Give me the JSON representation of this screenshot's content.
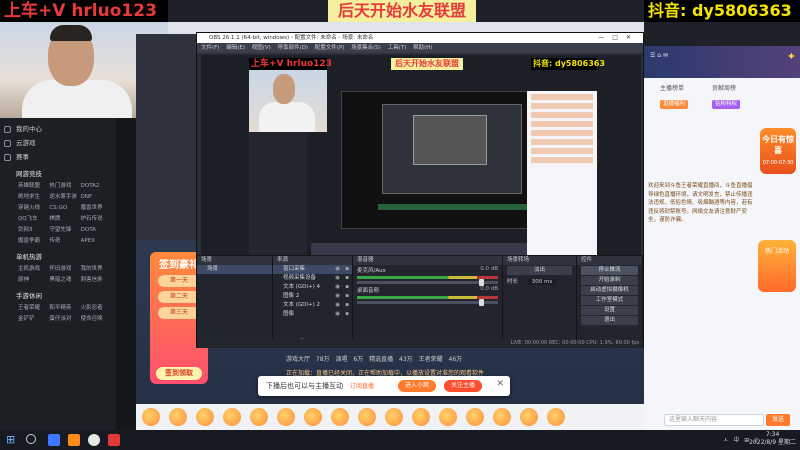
{
  "overlays": {
    "left": "上车+V hrluo123",
    "center": "后天开始水友联盟",
    "right": "抖音: dy5806363"
  },
  "obs": {
    "title": "OBS 26.1.1 (64-bit, windows) - 配置文件: 未命名 - 场景: 未命名",
    "menu": "文件(F) 编辑(E) 视图(V) 停靠部件(D) 配置文件(P) 场景集合(S) 工具(T) 帮助(H)",
    "preview_banners": {
      "left": "上车+V hrluo123",
      "center": "后天开始水友联盟",
      "right": "抖音: dy5806363"
    },
    "docks": {
      "scenes": {
        "title": "场景",
        "items": [
          "场景"
        ]
      },
      "sources": {
        "title": "来源",
        "items": [
          "窗口采集",
          "视频采集设备",
          "文本 (GDI+) 4",
          "图像 2",
          "文本 (GDI+) 2",
          "图像"
        ]
      },
      "mixer": {
        "title": "混音器",
        "channels": [
          {
            "name": "麦克风/Aux",
            "db": "0.0 dB"
          },
          {
            "name": "桌面音频",
            "db": "0.0 dB"
          }
        ]
      },
      "transitions": {
        "title": "场景转场",
        "type": "淡出",
        "duration_label": "时长",
        "duration": "300 ms"
      },
      "controls": {
        "title": "控件",
        "buttons": [
          "停止推流",
          "开始录制",
          "启动虚拟摄像机",
          "工作室模式",
          "设置",
          "退出"
        ]
      }
    },
    "status": "LIVE: 00:00:00   REC: 00:00:00   CPU: 1.9%, 60.00 fps"
  },
  "stream_list": [
    "游戏大厅",
    "78万",
    "演唱",
    "6万",
    "精选直播",
    "43万",
    "王者荣耀",
    "46万"
  ],
  "notice": "正在加载：直播已经关闭，正在帮助加载中，以播放设置对准您的观看软件",
  "popup": {
    "message": "下播后也可以与主播互动",
    "link": "订阅直播",
    "login_button": "进入小窝",
    "join_button": "关注主播"
  },
  "signin": {
    "title": "签到豪礼",
    "items": [
      "第一天",
      "第二天",
      "第三天"
    ],
    "go": "签到领取"
  },
  "sidebar": {
    "top_items": [
      "我的中心",
      "云游戏",
      "赛事"
    ],
    "sections": [
      {
        "title": "网游竞技",
        "items": [
          "英雄联盟",
          "热门游戏",
          "DOTA2",
          "绝地求生",
          "逆水寒手游",
          "DNF",
          "穿越火线",
          "CS:GO",
          "魔兽世界",
          "QQ飞车",
          "棋牌",
          "炉石传说",
          "剑网3",
          "守望先锋",
          "DOTA",
          "魔兽争霸",
          "传奇",
          "APEX"
        ]
      },
      {
        "title": "单机热游",
        "items": [
          "主机游戏",
          "怀旧游戏",
          "我的世界",
          "原神",
          "黑暗之魂",
          "刺客信条"
        ]
      },
      {
        "title": "手游休闲",
        "items": [
          "王者荣耀",
          "和平精英",
          "火影忍者",
          "金铲铲",
          "蛋仔派对",
          "使命召唤"
        ]
      }
    ]
  },
  "right_panel": {
    "tabs": [
      "主播榜单",
      "贡献周榜"
    ],
    "chips": [
      "直播福利",
      "钻粉特权"
    ],
    "chat": "欢迎来到斗鱼王者荣耀直播间，斗鱼直播倡导绿色直播环境，请文明发言，禁止传播违法违规、低俗色情、吸烟酗酒等内容，若有违反将封禁账号。网络交友请注意财产安全，谨防诈骗。",
    "badge": "今日有惊喜",
    "badge_sub": "07:00-07:30",
    "badge2": "热门活动",
    "input_placeholder": "这里输入聊天内容",
    "send": "发送"
  },
  "taskbar": {
    "tray": "ㅅ 中 ⊞ ♪",
    "time": "7:34",
    "date": "2022/8/9 星期二"
  }
}
